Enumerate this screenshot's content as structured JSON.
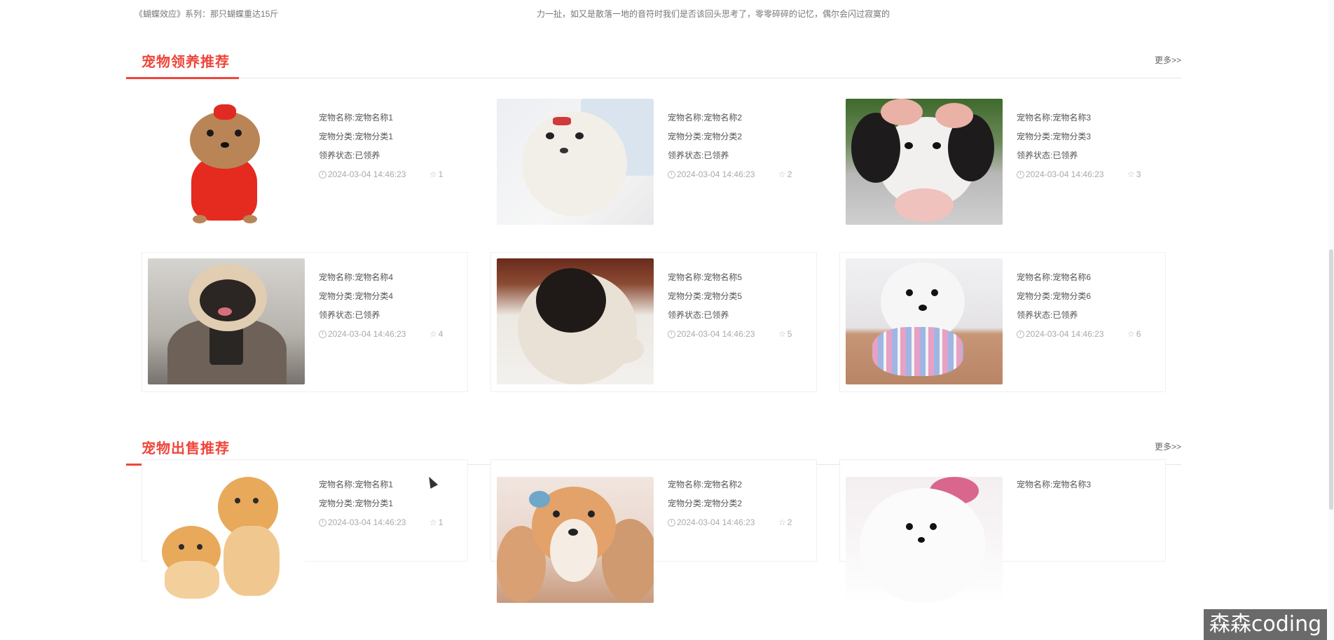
{
  "top_line": {
    "left_text": "《蝴蝶效应》系列：那只蝴蝶重达15斤",
    "center_text": "力一扯，如又是散落一地的音符时我们是否该回头思考了，零零碎碎的记忆，偶尔会闪过寂寞的"
  },
  "adoption": {
    "title": "宠物领养推荐",
    "more": "更多>>",
    "cards": [
      {
        "name": "宠物名称:宠物名称1",
        "category": "宠物分类:宠物分类1",
        "status": "领养状态:已领养",
        "date": "2024-03-04 14:46:23",
        "likes": "1",
        "image": "yorkie-red-sweater"
      },
      {
        "name": "宠物名称:宠物名称2",
        "category": "宠物分类:宠物分类2",
        "status": "领养状态:已领养",
        "date": "2024-03-04 14:46:23",
        "likes": "2",
        "image": "white-maltese"
      },
      {
        "name": "宠物名称:宠物名称3",
        "category": "宠物分类:宠物分类3",
        "status": "领养状态:已领养",
        "date": "2024-03-04 14:46:23",
        "likes": "3",
        "image": "black-white-poodle"
      },
      {
        "name": "宠物名称:宠物名称4",
        "category": "宠物分类:宠物分类4",
        "status": "领养状态:已领养",
        "date": "2024-03-04 14:46:23",
        "likes": "4",
        "image": "pug-in-suit"
      },
      {
        "name": "宠物名称:宠物名称5",
        "category": "宠物分类:宠物分类5",
        "status": "领养状态:已领养",
        "date": "2024-03-04 14:46:23",
        "likes": "5",
        "image": "pug-puppy"
      },
      {
        "name": "宠物名称:宠物名称6",
        "category": "宠物分类:宠物分类6",
        "status": "领养状态:已领养",
        "date": "2024-03-04 14:46:23",
        "likes": "6",
        "image": "bichon-striped-shirt"
      }
    ]
  },
  "sale": {
    "title": "宠物出售推荐",
    "more": "更多>>",
    "cards": [
      {
        "name": "宠物名称:宠物名称1",
        "category": "宠物分类:宠物分类1",
        "date": "2024-03-04 14:46:23",
        "likes": "1",
        "image": "two-orange-kittens"
      },
      {
        "name": "宠物名称:宠物名称2",
        "category": "宠物分类:宠物分类2",
        "date": "2024-03-04 14:46:23",
        "likes": "2",
        "image": "corgi-puppy"
      },
      {
        "name": "宠物名称:宠物名称3",
        "category": "",
        "date": "",
        "likes": "",
        "image": "white-pomeranian"
      }
    ]
  },
  "watermark": "森森coding",
  "colors": {
    "accent": "#f0453a",
    "text": "#555555",
    "muted": "#aaaaaa",
    "border": "#f0f0f0"
  }
}
